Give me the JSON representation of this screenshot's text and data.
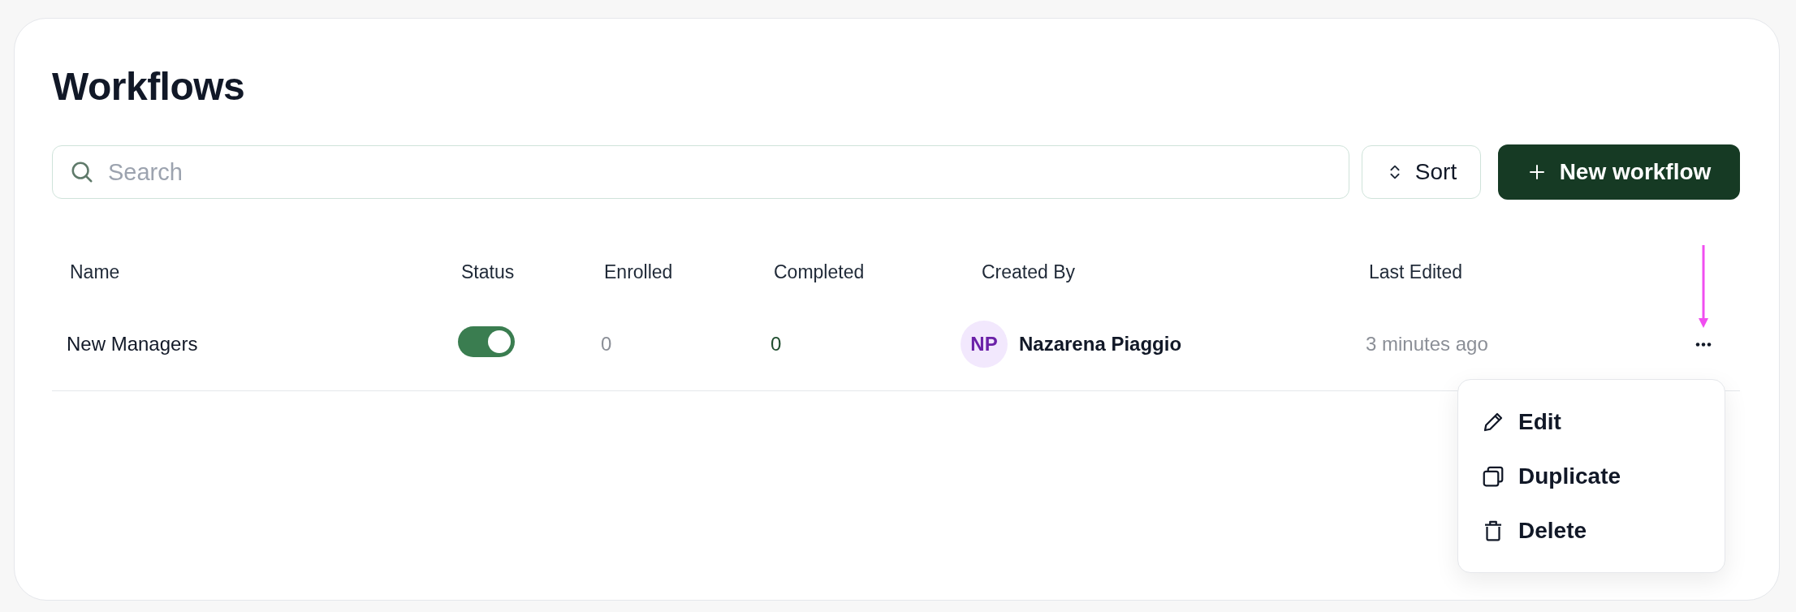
{
  "title": "Workflows",
  "search": {
    "placeholder": "Search"
  },
  "sort_button": {
    "label": "Sort"
  },
  "new_button": {
    "label": "New workflow"
  },
  "table": {
    "columns": [
      "Name",
      "Status",
      "Enrolled",
      "Completed",
      "Created By",
      "Last Edited"
    ],
    "rows": [
      {
        "name": "New Managers",
        "status_on": true,
        "enrolled": "0",
        "completed": "0",
        "creator_initials": "NP",
        "creator": "Nazarena Piaggio",
        "last_edited": "3 minutes ago"
      }
    ]
  },
  "row_menu": {
    "items": [
      {
        "kind": "edit",
        "label": "Edit"
      },
      {
        "kind": "duplicate",
        "label": "Duplicate"
      },
      {
        "kind": "delete",
        "label": "Delete"
      }
    ]
  }
}
